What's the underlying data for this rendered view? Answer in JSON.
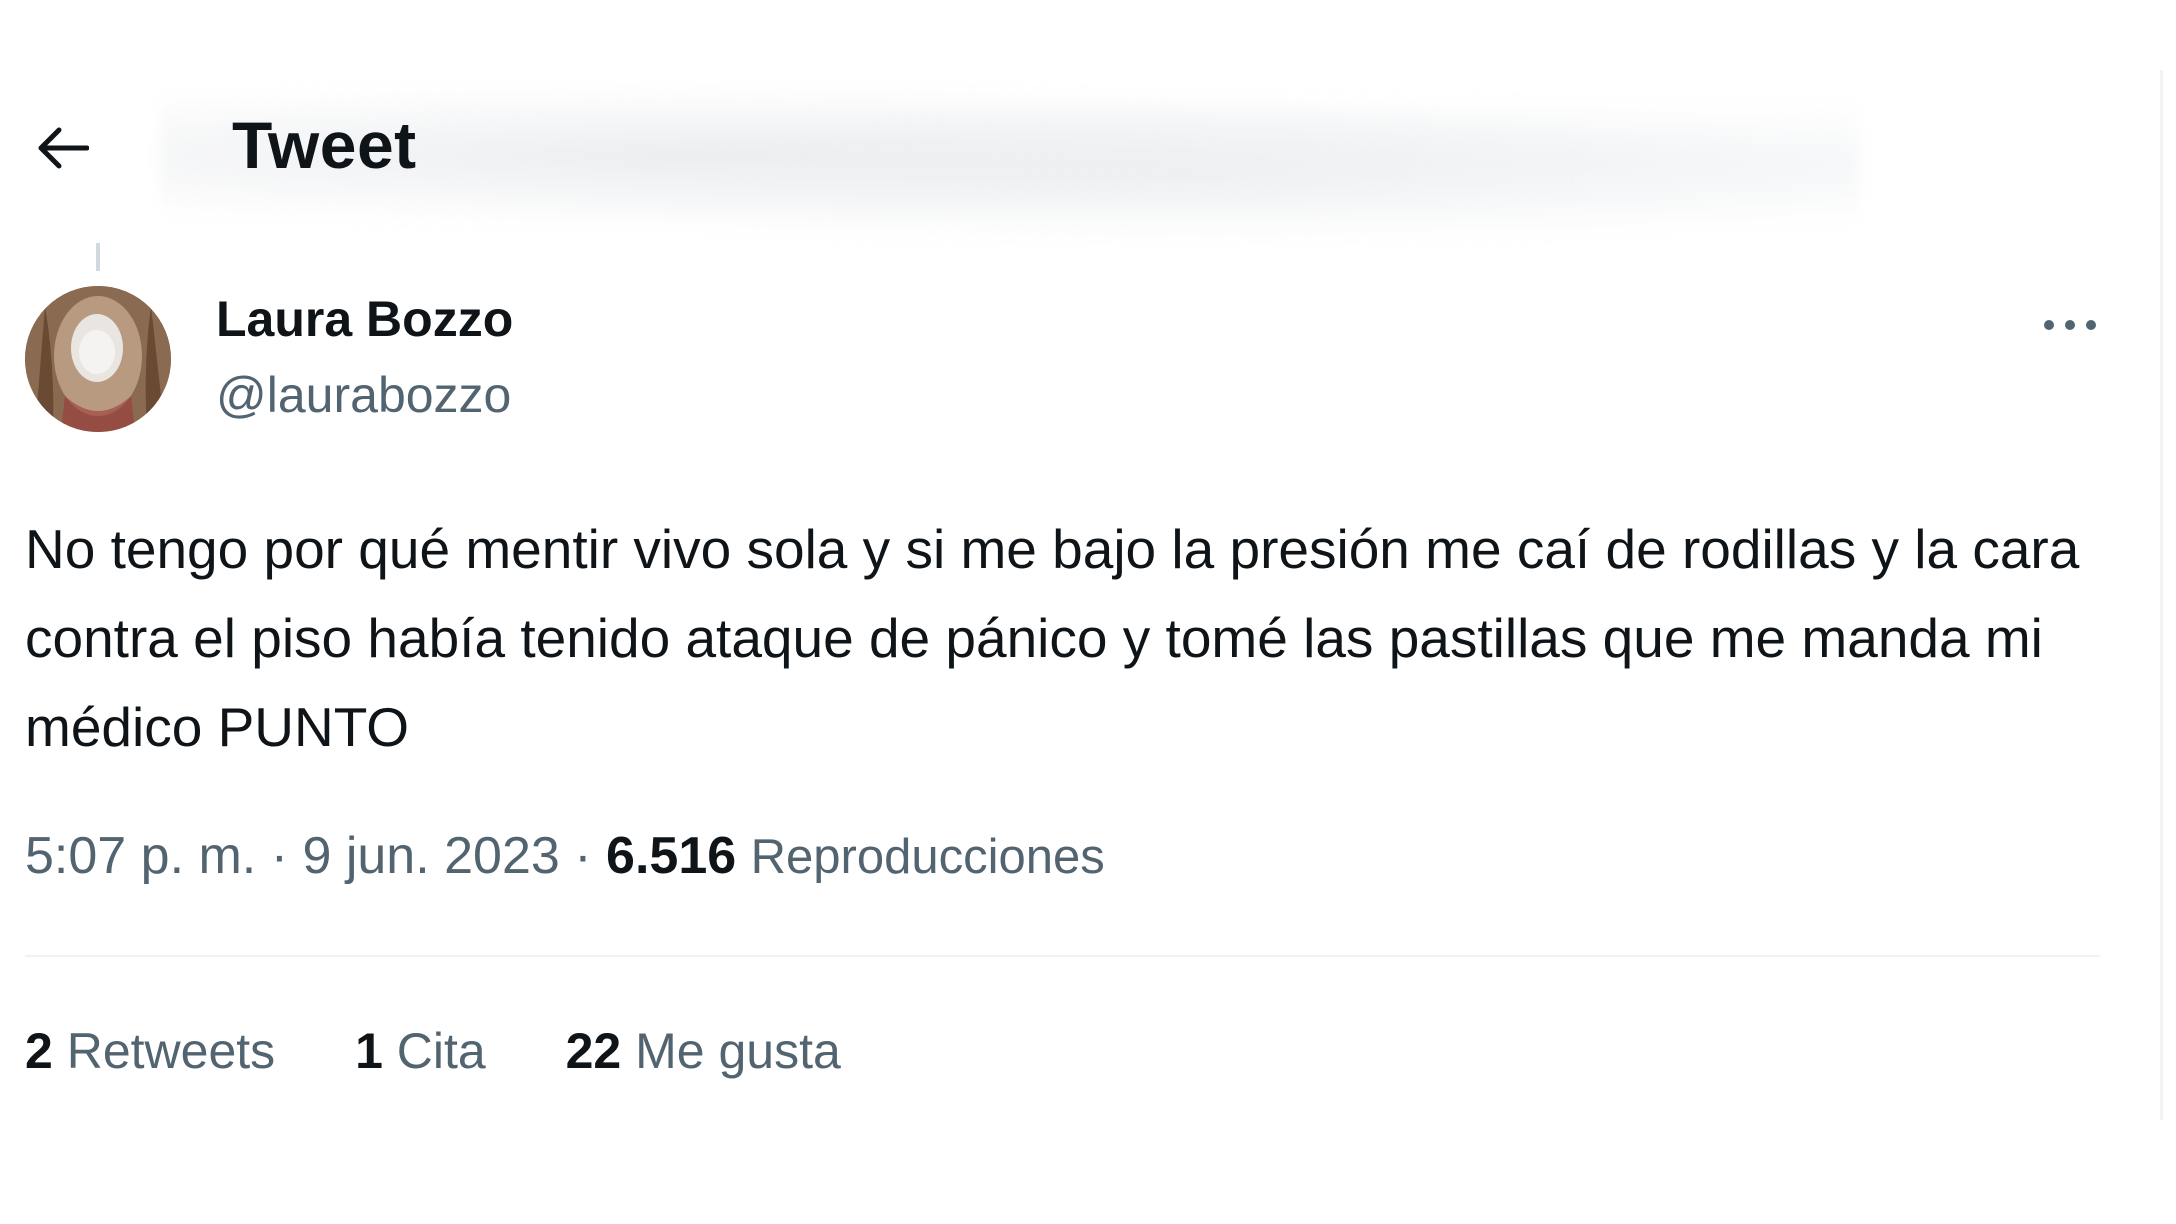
{
  "header": {
    "title": "Tweet",
    "back_icon": "arrow-left-icon"
  },
  "author": {
    "name": "Laura Bozzo",
    "handle": "@laurabozzo"
  },
  "tweet": {
    "text": "No tengo por qué mentir vivo sola y si me bajo la presión me caí de rodillas y la cara contra el piso había tenido ataque de pánico y tomé las pastillas que me manda mi médico PUNTO",
    "time": "5:07 p. m.",
    "separator": "·",
    "date": "9 jun. 2023",
    "views_count": "6.516",
    "views_label": "Reproducciones"
  },
  "stats": {
    "retweets_count": "2",
    "retweets_label": "Retweets",
    "quotes_count": "1",
    "quotes_label": "Cita",
    "likes_count": "22",
    "likes_label": "Me gusta"
  },
  "colors": {
    "text_primary": "#0f1419",
    "text_secondary": "#536471",
    "divider": "#eff3f4"
  }
}
